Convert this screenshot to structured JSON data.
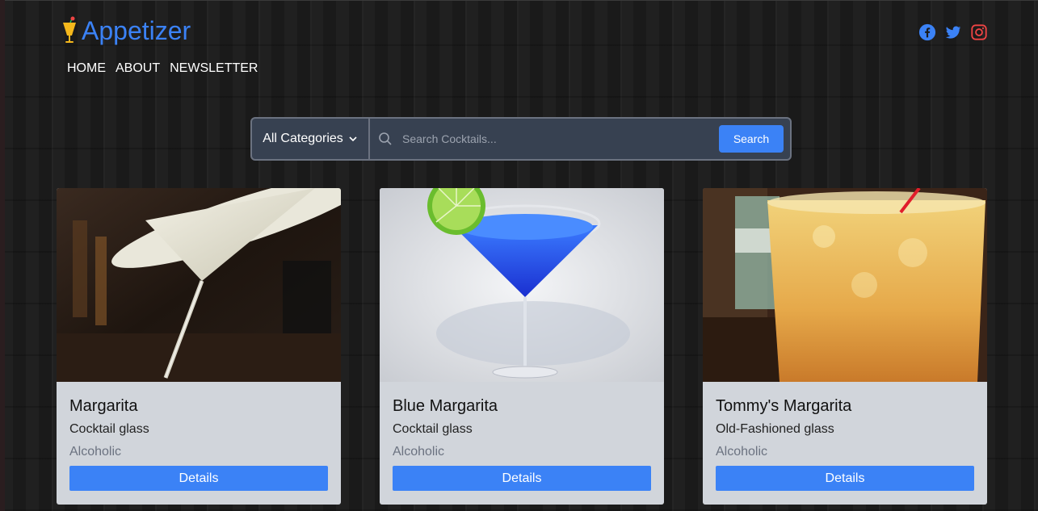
{
  "brand": {
    "name": "Appetizer",
    "logo_icon": "cocktail-glass-icon"
  },
  "nav": {
    "items": [
      {
        "label": "HOME"
      },
      {
        "label": "ABOUT"
      },
      {
        "label": "NEWSLETTER"
      }
    ]
  },
  "socials": [
    {
      "icon": "facebook-icon",
      "color": "#3b82f6"
    },
    {
      "icon": "twitter-icon",
      "color": "#3b82f6"
    },
    {
      "icon": "instagram-icon",
      "color": "#ef4444"
    }
  ],
  "search": {
    "category_selected": "All Categories",
    "placeholder": "Search Cocktails...",
    "value": "",
    "button_label": "Search"
  },
  "colors": {
    "accent": "#3b82f6",
    "card_bg": "#d1d5db",
    "search_bg": "#374151"
  },
  "cards": [
    {
      "title": "Margarita",
      "glass": "Cocktail glass",
      "type": "Alcoholic",
      "button_label": "Details"
    },
    {
      "title": "Blue Margarita",
      "glass": "Cocktail glass",
      "type": "Alcoholic",
      "button_label": "Details"
    },
    {
      "title": "Tommy's Margarita",
      "glass": "Old-Fashioned glass",
      "type": "Alcoholic",
      "button_label": "Details"
    }
  ]
}
